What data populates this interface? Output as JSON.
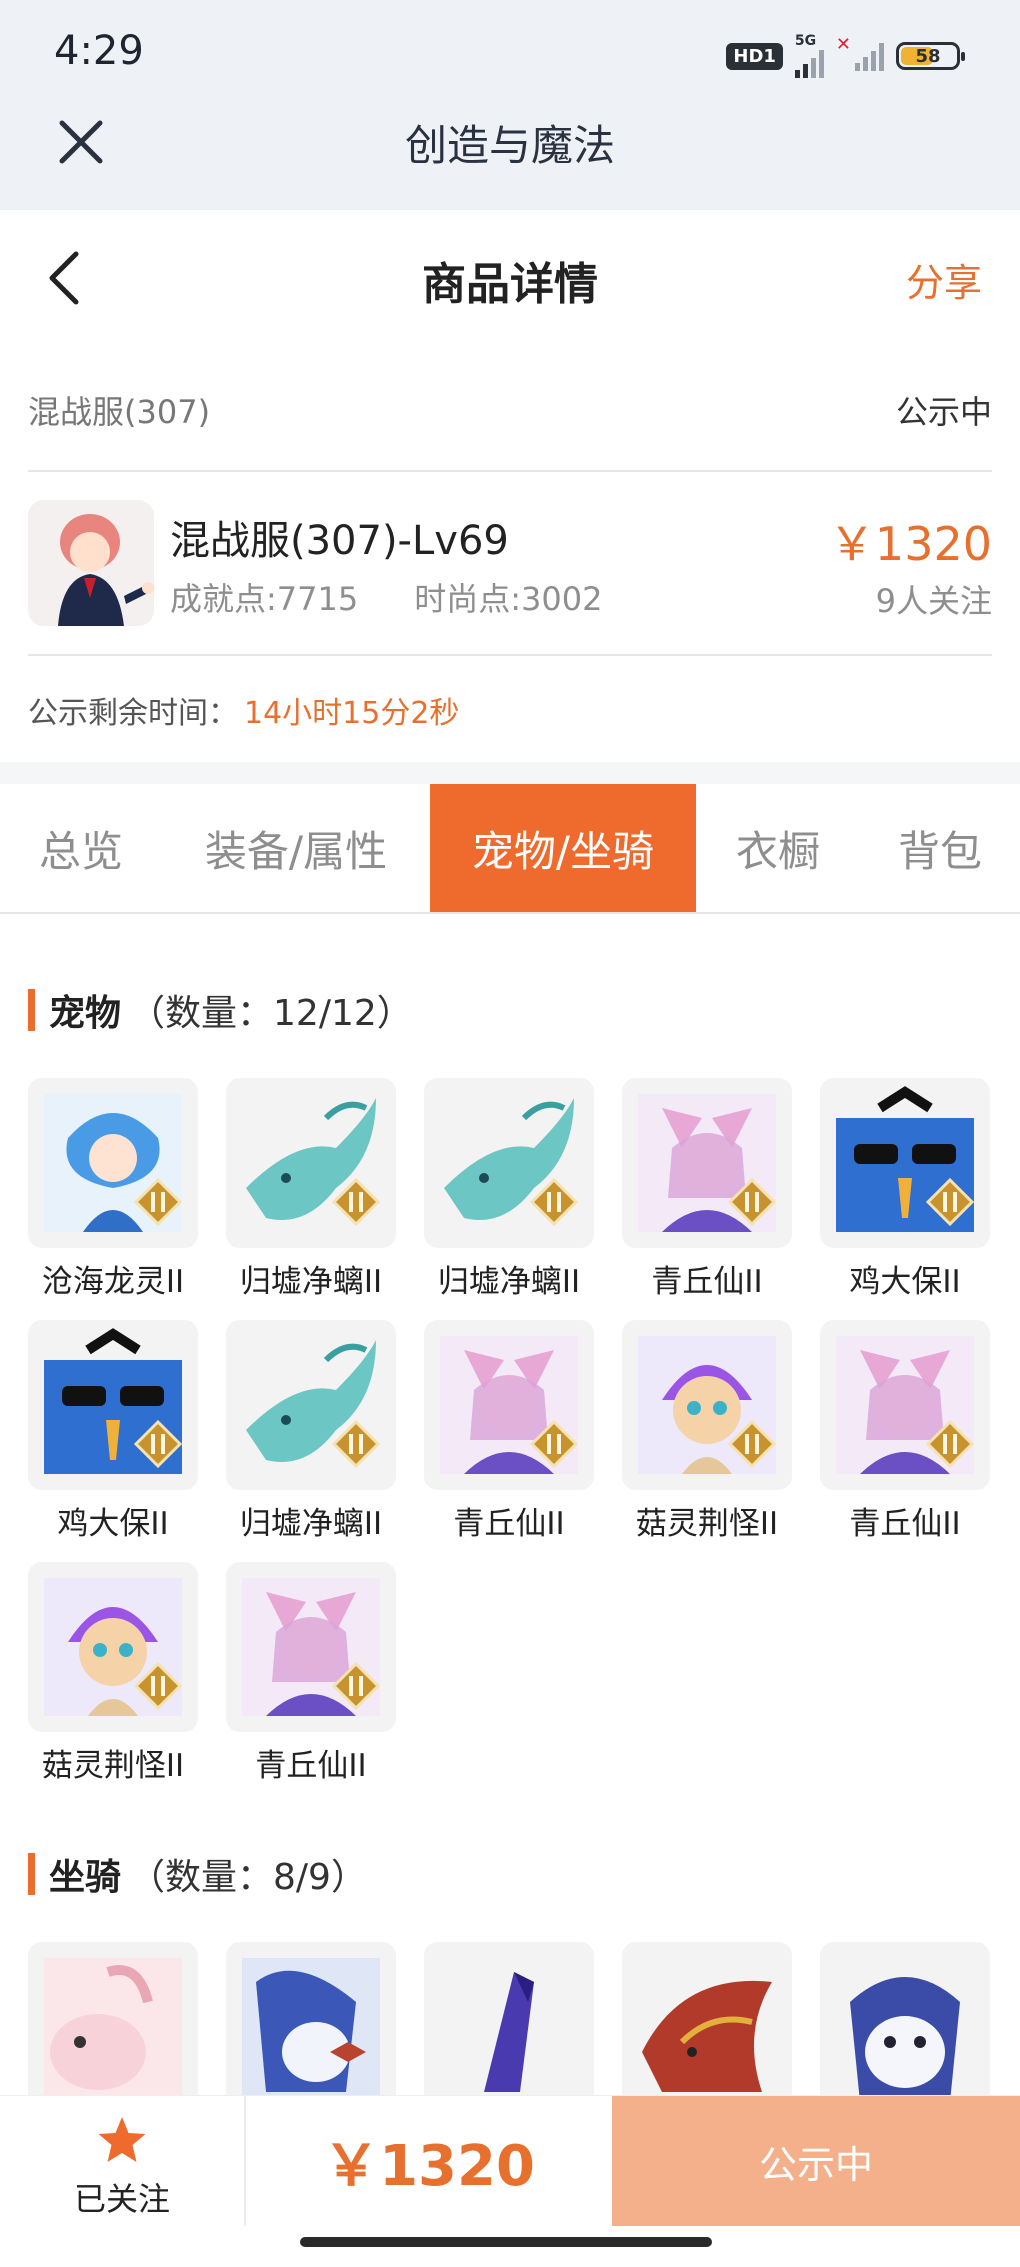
{
  "status_bar": {
    "time": "4:29",
    "hd": "HD1",
    "network": "5G",
    "battery": "58"
  },
  "app_bar": {
    "title": "创造与魔法"
  },
  "nav": {
    "title": "商品详情",
    "share": "分享"
  },
  "server": {
    "name": "混战服(307)",
    "status": "公示中"
  },
  "product": {
    "title": "混战服(307)-Lv69",
    "achievement": "成就点:7715",
    "fashion": "时尚点:3002",
    "price": "￥1320",
    "followers": "9人关注"
  },
  "timer": {
    "label": "公示剩余时间：",
    "value": "14小时15分2秒"
  },
  "tabs": [
    {
      "label": "总览"
    },
    {
      "label": "装备/属性"
    },
    {
      "label": "宠物/坐骑"
    },
    {
      "label": "衣橱"
    },
    {
      "label": "背包"
    }
  ],
  "pets": {
    "title": "宠物",
    "count": "（数量：12/12）",
    "items": [
      {
        "name": "沧海龙灵II"
      },
      {
        "name": "归墟净螭II"
      },
      {
        "name": "归墟净螭II"
      },
      {
        "name": "青丘仙II"
      },
      {
        "name": "鸡大保II"
      },
      {
        "name": "鸡大保II"
      },
      {
        "name": "归墟净螭II"
      },
      {
        "name": "青丘仙II"
      },
      {
        "name": "菇灵荆怪II"
      },
      {
        "name": "青丘仙II"
      },
      {
        "name": "菇灵荆怪II"
      },
      {
        "name": "青丘仙II"
      }
    ]
  },
  "mounts": {
    "title": "坐骑",
    "count": "（数量：8/9）"
  },
  "bottom": {
    "follow_label": "已关注",
    "price": "￥1320",
    "cta": "公示中"
  },
  "colors": {
    "accent": "#ef6a2d",
    "price": "#e8702f",
    "cta_disabled": "#f3b08a"
  }
}
